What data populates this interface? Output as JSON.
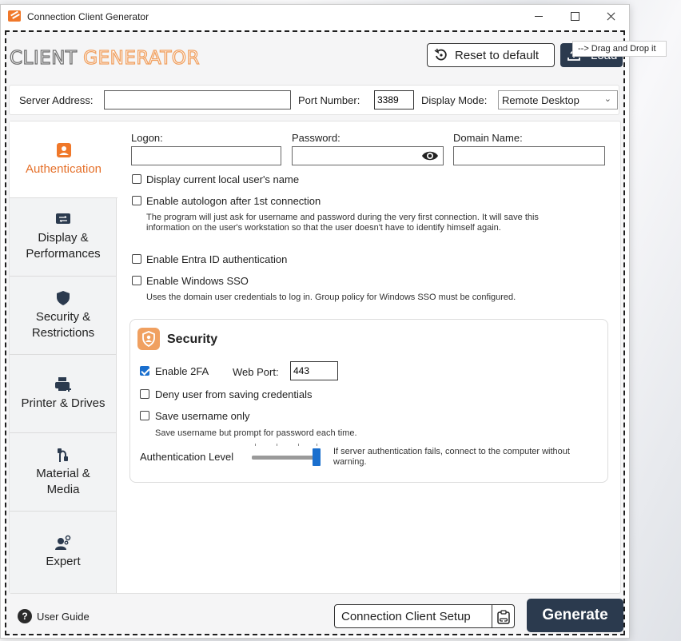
{
  "window": {
    "title": "Connection Client Generator"
  },
  "header": {
    "logo_part1": "CLIENT",
    "logo_part2": "GENERATOR",
    "reset_label": "Reset to default",
    "load_label": "Load",
    "tooltip": "--> Drag and Drop it"
  },
  "server": {
    "address_label": "Server Address:",
    "address_value": "",
    "port_label": "Port Number:",
    "port_value": "3389",
    "mode_label": "Display Mode:",
    "mode_value": "Remote Desktop"
  },
  "sidebar": {
    "items": [
      {
        "label": "Authentication",
        "icon": "user-badge-icon",
        "active": true
      },
      {
        "label": "Display & Performances",
        "icon": "display-icon"
      },
      {
        "label": "Security & Restrictions",
        "icon": "shield-icon"
      },
      {
        "label": "Printer & Drives",
        "icon": "printer-icon"
      },
      {
        "label": "Material & Media",
        "icon": "media-icon"
      },
      {
        "label": "Expert",
        "icon": "expert-icon"
      }
    ]
  },
  "auth": {
    "logon_label": "Logon:",
    "logon_value": "",
    "password_label": "Password:",
    "password_value": "",
    "domain_label": "Domain Name:",
    "domain_value": "",
    "opt_display_user": "Display current local user's name",
    "opt_autologon": "Enable autologon after 1st connection",
    "autologon_desc": "The program will just ask for username and password during the very first connection. It will save this information on the user's workstation so that the user doesn't have to identify himself again.",
    "opt_entra": "Enable Entra ID authentication",
    "opt_sso": "Enable Windows SSO",
    "sso_desc": "Uses the domain user credentials to log in. Group policy for Windows SSO must be configured."
  },
  "security": {
    "title": "Security",
    "opt_2fa": "Enable 2FA",
    "opt_2fa_checked": true,
    "web_port_label": "Web Port:",
    "web_port_value": "443",
    "opt_deny_save": "Deny user from saving credentials",
    "opt_save_username": "Save username only",
    "save_username_desc": "Save username but prompt for password each time.",
    "auth_level_label": "Authentication Level",
    "auth_level_value": 1.0,
    "auth_level_desc": "If server authentication fails, connect to the computer without warning."
  },
  "footer": {
    "user_guide": "User Guide",
    "setup_label": "Connection Client Setup",
    "generate_label": "Generate"
  },
  "colors": {
    "accent": "#f0782a",
    "primary_dark": "#2b3a4e",
    "check_blue": "#1a6fce"
  }
}
